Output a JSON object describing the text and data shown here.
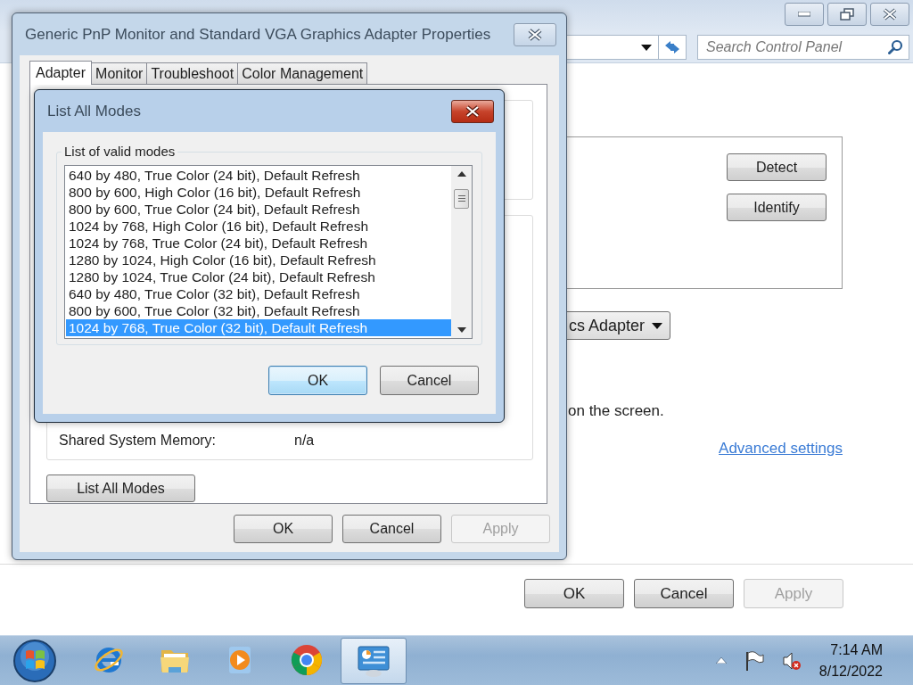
{
  "control_panel": {
    "search": {
      "placeholder": "Search Control Panel"
    },
    "display_buttons": [
      "Detect",
      "Identify"
    ],
    "adapter_dropdown": {
      "value": "cs Adapter"
    },
    "description": "on the screen.",
    "link": "Advanced settings",
    "buttons": [
      {
        "label": "OK",
        "disabled": false
      },
      {
        "label": "Cancel",
        "disabled": false
      },
      {
        "label": "Apply",
        "disabled": true
      }
    ]
  },
  "properties_dialog": {
    "title": "Generic PnP Monitor and Standard VGA Graphics Adapter Properties",
    "tabs": [
      {
        "label": "Adapter",
        "selected": true
      },
      {
        "label": "Monitor",
        "selected": false
      },
      {
        "label": "Troubleshoot",
        "selected": false
      },
      {
        "label": "Color Management",
        "selected": false
      }
    ],
    "memory_label": "Shared System Memory:",
    "memory_value": "n/a",
    "list_modes_button": "List All Modes",
    "buttons": [
      {
        "label": "OK",
        "disabled": false
      },
      {
        "label": "Cancel",
        "disabled": false
      },
      {
        "label": "Apply",
        "disabled": true
      }
    ]
  },
  "modes_dialog": {
    "title": "List All Modes",
    "group_label": "List of valid modes",
    "modes": [
      {
        "label": "640 by 480, True Color (24 bit), Default Refresh",
        "selected": false
      },
      {
        "label": "800 by 600, High Color (16 bit), Default Refresh",
        "selected": false
      },
      {
        "label": "800 by 600, True Color (24 bit), Default Refresh",
        "selected": false
      },
      {
        "label": "1024 by 768, High Color (16 bit), Default Refresh",
        "selected": false
      },
      {
        "label": "1024 by 768, True Color (24 bit), Default Refresh",
        "selected": false
      },
      {
        "label": "1280 by 1024, High Color (16 bit), Default Refresh",
        "selected": false
      },
      {
        "label": "1280 by 1024, True Color (24 bit), Default Refresh",
        "selected": false
      },
      {
        "label": "640 by 480, True Color (32 bit), Default Refresh",
        "selected": false
      },
      {
        "label": "800 by 600, True Color (32 bit), Default Refresh",
        "selected": false
      },
      {
        "label": "1024 by 768, True Color (32 bit), Default Refresh",
        "selected": true
      }
    ],
    "buttons": [
      {
        "label": "OK",
        "focused": true
      },
      {
        "label": "Cancel",
        "focused": false
      }
    ]
  },
  "taskbar": {
    "apps": [
      {
        "kind": "ie",
        "active": false
      },
      {
        "kind": "explorer",
        "active": false
      },
      {
        "kind": "media",
        "active": false
      },
      {
        "kind": "chrome",
        "active": false
      },
      {
        "kind": "control_panel",
        "active": true
      }
    ],
    "clock": {
      "time": "7:14 AM",
      "date": "8/12/2022"
    }
  }
}
